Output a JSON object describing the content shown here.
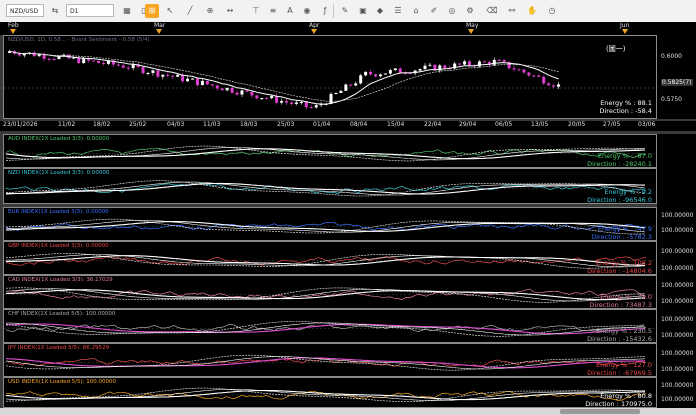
{
  "toolbar": {
    "symbol": "NZD/USD",
    "timeframe": "D1",
    "icons": [
      "chart-type-icon",
      "layout-icon",
      "crosshair-icon",
      "cursor-icon",
      "line-icon",
      "hline-icon",
      "vline-icon",
      "globe-icon",
      "indicator-icon",
      "pencil-icon",
      "text-icon",
      "image-icon",
      "shapes-icon",
      "list-icon",
      "tag-icon",
      "brush-icon",
      "eye-icon",
      "settings-icon",
      "eraser-icon",
      "link-icon",
      "hand-icon"
    ]
  },
  "timeline": {
    "months": [
      "Feb",
      "Mar",
      "Apr",
      "May",
      "Jun"
    ]
  },
  "price_panel": {
    "header": "NZD/USD, 1D, 0.58...  -  Bvsnt Sentiment - 0.58 (5/4)",
    "annotation": "(圖一)",
    "energy": "Energy % : 88.1",
    "direction": "Direction : -58.4",
    "axis_ticks": [
      "0.6000",
      "0.5825(7)",
      "0.5750"
    ],
    "dates": [
      "23/01/2026",
      "11/02",
      "18/02",
      "25/02",
      "04/03",
      "11/03",
      "18/03",
      "25/03",
      "01/04",
      "08/04",
      "15/04",
      "22/04",
      "29/04",
      "06/05",
      "13/05",
      "20/05",
      "27/05",
      "03/06"
    ]
  },
  "indicators": [
    {
      "label": "AUD INDEX(1X Loaded 3/3): 0.00000",
      "energy": "Energy % : -87.0",
      "direction": "Direction : -28240.1",
      "color": "#4fc36a",
      "text_color": "#4fc36a",
      "axis": ""
    },
    {
      "label": "NZD INDEX(1X Loaded 3/3): 0.00000",
      "energy": "Energy % : 9.2",
      "direction": "Direction : -96546.0",
      "color": "#37c7d8",
      "text_color": "#37c7d8",
      "axis": ""
    },
    {
      "label": "EUR INDEX(1X Loaded 3/3): 0.00000",
      "energy": "Energy % : -47.9",
      "direction": "Direction : -5782.3",
      "color": "#3a72ff",
      "text_color": "#3a72ff",
      "axis": "100.00000"
    },
    {
      "label": "GBP INDEX(1X Loaded 3/3): 0.00000",
      "energy": "Energy % : 108.2",
      "direction": "Direction : -14804.6",
      "color": "#e64a4a",
      "text_color": "#e64a4a",
      "axis": "100.00000"
    },
    {
      "label": "CAD INDEX(1X Loaded 3/3): 36.17029",
      "energy": "Energy % : 71.0",
      "direction": "Direction : 73487.3",
      "color": "#e07a9a",
      "text_color": "#e07a9a",
      "axis": "100.00000"
    },
    {
      "label": "CHF INDEX(1X Loaded 5/5): 100.00000",
      "energy": "Energy % : 230.5",
      "direction": "Direction : -15432.6",
      "color": "#aaaaaa",
      "text_color": "#aaaaaa",
      "axis": "100.00000"
    },
    {
      "label": "JPY INDEX(1X Loaded 5/5): 86.29529",
      "energy": "Energy % : 127.0",
      "direction": "Direction : -67969.5",
      "color": "#e64a4a",
      "text_color": "#e64a4a",
      "axis": "100.00000"
    },
    {
      "label": "USD INDEX(1X Loaded 5/5): 100.00000",
      "energy": "Energy % : 80.8",
      "direction": "Direction : 170975.0",
      "color": "#f5a623",
      "text_color": "#ffffff",
      "axis": "100.00000"
    }
  ],
  "colors": {
    "bull_candle": "#ffffff",
    "bear_candle": "#e040d0",
    "ma": "#ffffff",
    "accent": "#f5a623"
  }
}
